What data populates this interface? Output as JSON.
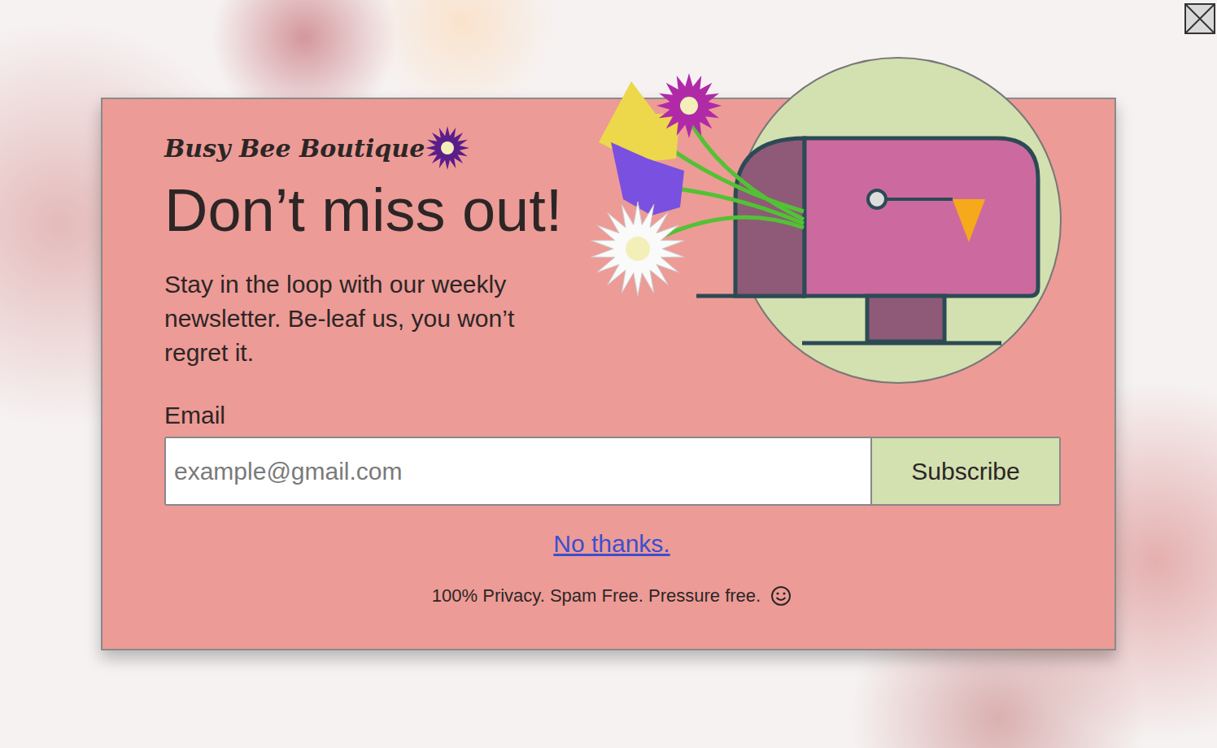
{
  "brand": {
    "name": "Busy Bee Boutique"
  },
  "heading": "Don’t miss out!",
  "message": "Stay in the loop with our weekly newsletter. Be-leaf us, you won’t regret it.",
  "form": {
    "label": "Email",
    "placeholder": "example@gmail.com",
    "button": "Subscribe"
  },
  "decline": "No thanks.",
  "footer": "100% Privacy. Spam Free. Pressure free."
}
